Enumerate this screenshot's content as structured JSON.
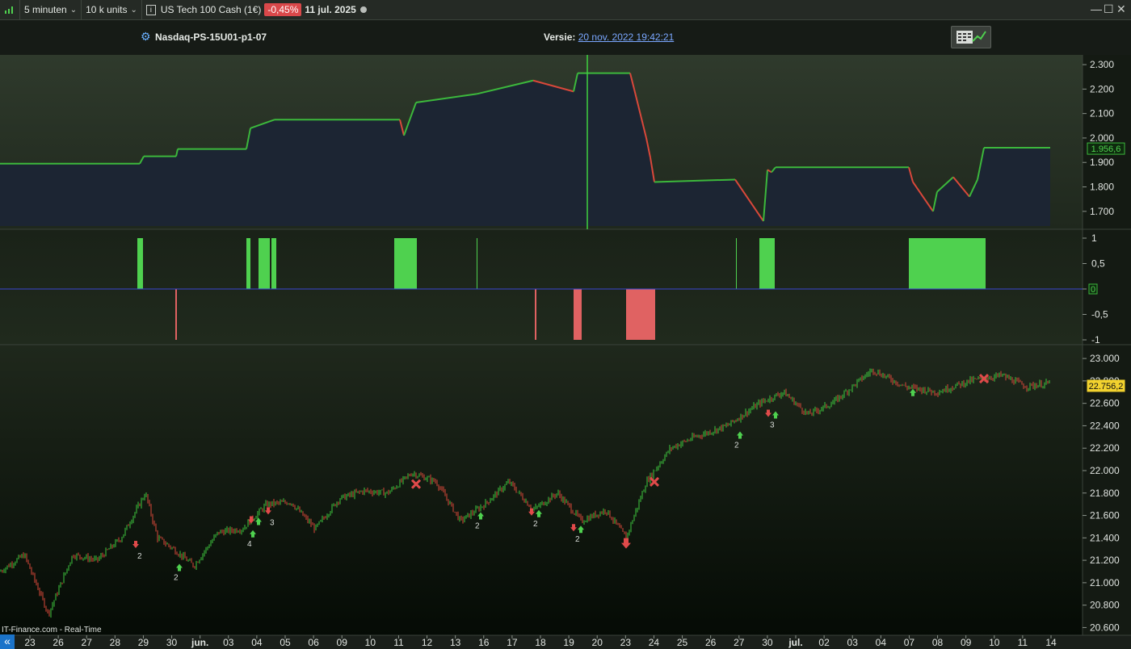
{
  "toolbar": {
    "timeframe": "5 minuten",
    "units": "10 k units",
    "instrument": "US Tech 100 Cash (1€)",
    "change": "-0,45%",
    "date": "11 jul. 2025"
  },
  "header": {
    "system_name": "Nasdaq-PS-15U01-p1-07",
    "version_label": "Versie:",
    "version_date": "20 nov. 2022 19:42:21"
  },
  "footer": {
    "source": "IT-Finance.com - Real-Time",
    "scroll_left": "«"
  },
  "colors": {
    "up": "#3cb83c",
    "down": "#d9483a",
    "bar_positive": "#4fd14f",
    "bar_negative": "#e06262",
    "equity_fill": "#1c2533",
    "zero_line": "#3a46d0",
    "cursor": "#3fd13f"
  },
  "chart_data": [
    {
      "type": "line",
      "name": "equity",
      "ylim": [
        1640,
        2320
      ],
      "y_ticks": [
        "2.300",
        "2.200",
        "2.100",
        "2.000",
        "1.900",
        "1.800",
        "1.700"
      ],
      "last_value": "1.956,6",
      "x": [
        0,
        173,
        178,
        218,
        220,
        305,
        310,
        340,
        495,
        500,
        515,
        590,
        660,
        710,
        715,
        780,
        785,
        800,
        805,
        810,
        910,
        945,
        950,
        955,
        960,
        1125,
        1130,
        1155,
        1160,
        1180,
        1200,
        1210,
        1218,
        1300
      ],
      "y": [
        1895,
        1895,
        1925,
        1925,
        1955,
        1955,
        2040,
        2075,
        2075,
        2010,
        2145,
        2180,
        2235,
        2190,
        2265,
        2265,
        2200,
        2000,
        1920,
        1820,
        1830,
        1660,
        1870,
        1860,
        1880,
        1880,
        1820,
        1700,
        1780,
        1840,
        1760,
        1830,
        1960,
        1960
      ]
    },
    {
      "type": "bar",
      "name": "position",
      "ylim": [
        -1,
        1
      ],
      "y_ticks": [
        "1",
        "0,5",
        "0",
        "-0,5",
        "-1"
      ],
      "bars": [
        {
          "x0": 170,
          "x1": 177,
          "v": 1
        },
        {
          "x0": 305,
          "x1": 310,
          "v": 1
        },
        {
          "x0": 320,
          "x1": 334,
          "v": 1
        },
        {
          "x0": 336,
          "x1": 342,
          "v": 1
        },
        {
          "x0": 488,
          "x1": 516,
          "v": 1
        },
        {
          "x0": 590,
          "x1": 591,
          "v": 1
        },
        {
          "x0": 911,
          "x1": 912,
          "v": 1
        },
        {
          "x0": 940,
          "x1": 959,
          "v": 1
        },
        {
          "x0": 1125,
          "x1": 1220,
          "v": 1
        },
        {
          "x0": 217,
          "x1": 219,
          "v": -1
        },
        {
          "x0": 662,
          "x1": 664,
          "v": -1
        },
        {
          "x0": 710,
          "x1": 720,
          "v": -1
        },
        {
          "x0": 775,
          "x1": 811,
          "v": -1
        }
      ]
    },
    {
      "type": "candlestick",
      "name": "US Tech 100 Cash (1€)",
      "ylim": [
        20560,
        23080
      ],
      "y_ticks": [
        "23.000",
        "22.800",
        "22.600",
        "22.400",
        "22.200",
        "22.000",
        "21.800",
        "21.600",
        "21.400",
        "21.200",
        "21.000",
        "20.800",
        "20.600"
      ],
      "last_value": "22.756,2",
      "x_labels": [
        "23",
        "26",
        "27",
        "28",
        "29",
        "30",
        "jun.",
        "03",
        "04",
        "05",
        "06",
        "09",
        "10",
        "11",
        "12",
        "13",
        "16",
        "17",
        "18",
        "19",
        "20",
        "23",
        "24",
        "25",
        "26",
        "27",
        "30",
        "jul.",
        "02",
        "03",
        "04",
        "07",
        "08",
        "09",
        "10",
        "11",
        "14"
      ],
      "path_x": [
        0,
        30,
        60,
        90,
        120,
        150,
        180,
        195,
        215,
        240,
        270,
        300,
        330,
        360,
        390,
        420,
        450,
        480,
        510,
        540,
        570,
        600,
        630,
        660,
        690,
        720,
        750,
        775,
        800,
        830,
        860,
        900,
        940,
        970,
        1000,
        1030,
        1080,
        1120,
        1160,
        1200,
        1240,
        1270,
        1300
      ],
      "path_y": [
        21100,
        21250,
        20720,
        21250,
        21200,
        21400,
        21800,
        21400,
        21300,
        21150,
        21450,
        21480,
        21700,
        21720,
        21480,
        21750,
        21820,
        21800,
        21980,
        21900,
        21550,
        21700,
        21900,
        21650,
        21800,
        21550,
        21650,
        21400,
        21900,
        22200,
        22300,
        22400,
        22600,
        22700,
        22500,
        22600,
        22900,
        22750,
        22700,
        22800,
        22850,
        22750,
        22780
      ],
      "signals": [
        {
          "x": 172,
          "y": 21330,
          "dir": "down",
          "label": "2"
        },
        {
          "x": 217,
          "y": 21140,
          "dir": "up",
          "label": "2"
        },
        {
          "x": 308,
          "y": 21440,
          "dir": "up",
          "label": "4"
        },
        {
          "x": 315,
          "y": 21550,
          "dir": "updown",
          "label": ""
        },
        {
          "x": 336,
          "y": 21630,
          "dir": "down",
          "label": "3"
        },
        {
          "x": 515,
          "y": 21880,
          "dir": "x",
          "label": ""
        },
        {
          "x": 590,
          "y": 21600,
          "dir": "up",
          "label": "2"
        },
        {
          "x": 662,
          "y": 21620,
          "dir": "updown",
          "label": "2"
        },
        {
          "x": 714,
          "y": 21480,
          "dir": "updown",
          "label": "2"
        },
        {
          "x": 775,
          "y": 21340,
          "dir": "downbig",
          "label": ""
        },
        {
          "x": 810,
          "y": 21900,
          "dir": "x",
          "label": ""
        },
        {
          "x": 911,
          "y": 22320,
          "dir": "up",
          "label": "2"
        },
        {
          "x": 955,
          "y": 22500,
          "dir": "updown",
          "label": "3"
        },
        {
          "x": 1125,
          "y": 22700,
          "dir": "up",
          "label": ""
        },
        {
          "x": 1218,
          "y": 22820,
          "dir": "x",
          "label": ""
        }
      ]
    }
  ]
}
